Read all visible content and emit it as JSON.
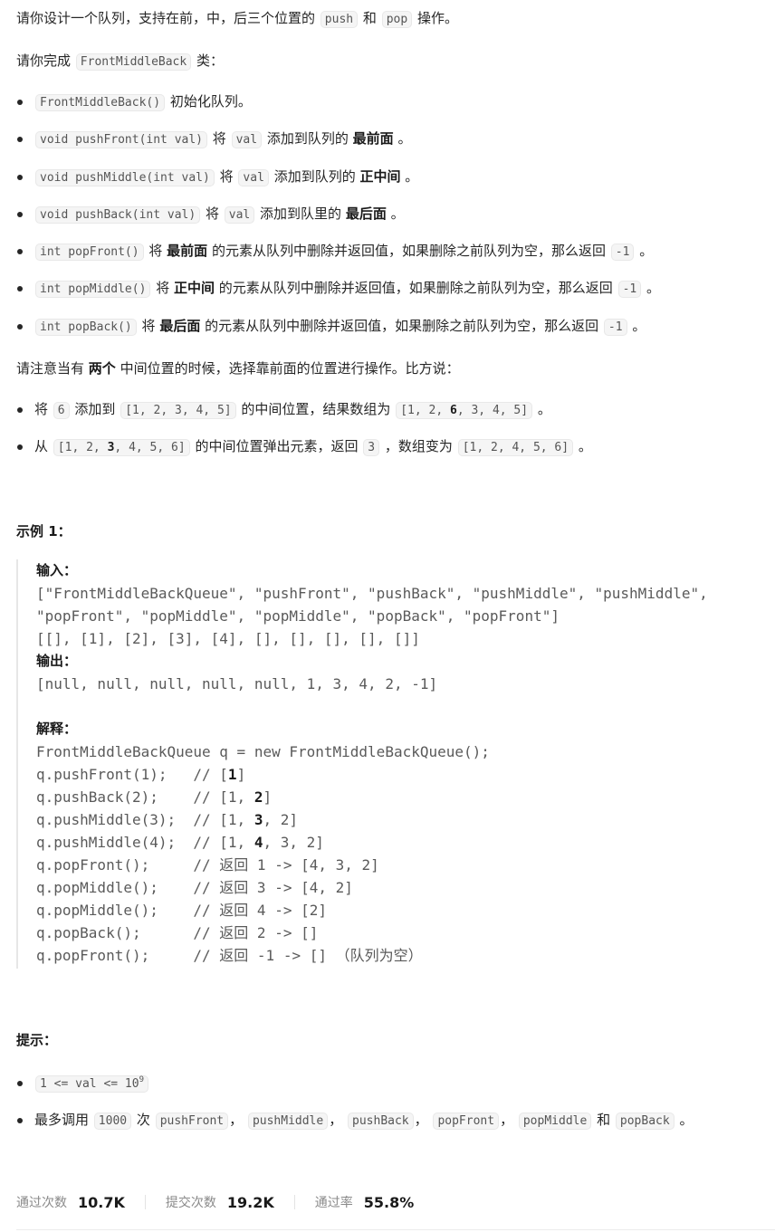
{
  "intro": {
    "t1": "请你设计一个队列，支持在前，中，后三个位置的",
    "push": "push",
    "and": "和",
    "pop": "pop",
    "t2": "操作。"
  },
  "class_line": {
    "t1": "请你完成",
    "class_name": "FrontMiddleBack",
    "t2": "类："
  },
  "methods": [
    {
      "code": "FrontMiddleBack()",
      "desc": "初始化队列。"
    },
    {
      "code": "void pushFront(int val)",
      "jiang": "将",
      "val": "val",
      "mid": "添加到队列的",
      "bold": "最前面",
      "end": "。"
    },
    {
      "code": "void pushMiddle(int val)",
      "jiang": "将",
      "val": "val",
      "mid": "添加到队列的",
      "bold": "正中间",
      "end": "。"
    },
    {
      "code": "void pushBack(int val)",
      "jiang": "将",
      "val": "val",
      "mid": "添加到队里的",
      "bold": "最后面",
      "end": "。"
    },
    {
      "code": "int popFront()",
      "jiang": "将",
      "bold": "最前面",
      "mid": "的元素从队列中删除并返回值，如果删除之前队列为空，那么返回",
      "neg": "-1",
      "end": "。"
    },
    {
      "code": "int popMiddle()",
      "jiang": "将",
      "bold": "正中间",
      "mid": "的元素从队列中删除并返回值，如果删除之前队列为空，那么返回",
      "neg": "-1",
      "end": "。"
    },
    {
      "code": "int popBack()",
      "jiang": "将",
      "bold": "最后面",
      "mid": "的元素从队列中删除并返回值，如果删除之前队列为空，那么返回",
      "neg": "-1",
      "end": "。"
    }
  ],
  "note": {
    "t1": "请注意当有",
    "bold": "两个",
    "t2": "中间位置的时候，选择靠前面的位置进行操作。比方说："
  },
  "examples_list": [
    {
      "t1": "将",
      "c1": "6",
      "t2": "添加到",
      "c2": "[1, 2, 3, 4, 5]",
      "t3": "的中间位置，结果数组为",
      "c3a": "[1, 2, ",
      "c3b": "6",
      "c3c": ", 3, 4, 5]",
      "end": "。"
    },
    {
      "t1": "从",
      "c1a": "[1, 2, ",
      "c1b": "3",
      "c1c": ", 4, 5, 6]",
      "t2": "的中间位置弹出元素，返回",
      "c2": "3",
      "t3": "，数组变为",
      "c3": "[1, 2, 4, 5, 6]",
      "end": "。"
    }
  ],
  "example1": {
    "heading": "示例 1：",
    "input_label": "输入：",
    "input_lines": [
      "[\"FrontMiddleBackQueue\", \"pushFront\", \"pushBack\", \"pushMiddle\", \"pushMiddle\",",
      "\"popFront\", \"popMiddle\", \"popMiddle\", \"popBack\", \"popFront\"]",
      "[[], [1], [2], [3], [4], [], [], [], [], []]"
    ],
    "output_label": "输出：",
    "output_line": "[null, null, null, null, null, 1, 3, 4, 2, -1]",
    "explain_label": "解释：",
    "explain_lines": [
      {
        "pre": "FrontMiddleBackQueue q = new FrontMiddleBackQueue();",
        "bold": "",
        "post": ""
      },
      {
        "pre": "q.pushFront(1);   // [",
        "bold": "1",
        "post": "]"
      },
      {
        "pre": "q.pushBack(2);    // [1, ",
        "bold": "2",
        "post": "]"
      },
      {
        "pre": "q.pushMiddle(3);  // [1, ",
        "bold": "3",
        "post": ", 2]"
      },
      {
        "pre": "q.pushMiddle(4);  // [1, ",
        "bold": "4",
        "post": ", 3, 2]"
      },
      {
        "pre": "q.popFront();     // 返回 1 -> [4, 3, 2]",
        "bold": "",
        "post": ""
      },
      {
        "pre": "q.popMiddle();    // 返回 3 -> [4, 2]",
        "bold": "",
        "post": ""
      },
      {
        "pre": "q.popMiddle();    // 返回 4 -> [2]",
        "bold": "",
        "post": ""
      },
      {
        "pre": "q.popBack();      // 返回 2 -> []",
        "bold": "",
        "post": ""
      },
      {
        "pre": "q.popFront();     // 返回 -1 -> [] （队列为空）",
        "bold": "",
        "post": ""
      }
    ]
  },
  "hints": {
    "heading": "提示：",
    "h1_code": "1 <= val <= 10",
    "h1_sup": "9",
    "h2": {
      "t1": "最多调用",
      "c1": "1000",
      "t2": "次",
      "c2": "pushFront",
      "s1": "，",
      "c3": "pushMiddle",
      "s2": "，",
      "c4": "pushBack",
      "s3": "，",
      "c5": "popFront",
      "s4": "，",
      "c6": "popMiddle",
      "and": "和",
      "c7": "popBack",
      "end": "。"
    }
  },
  "stats": {
    "accepted_label": "通过次数",
    "accepted_value": "10.7K",
    "submissions_label": "提交次数",
    "submissions_value": "19.2K",
    "rate_label": "通过率",
    "rate_value": "55.8%"
  }
}
